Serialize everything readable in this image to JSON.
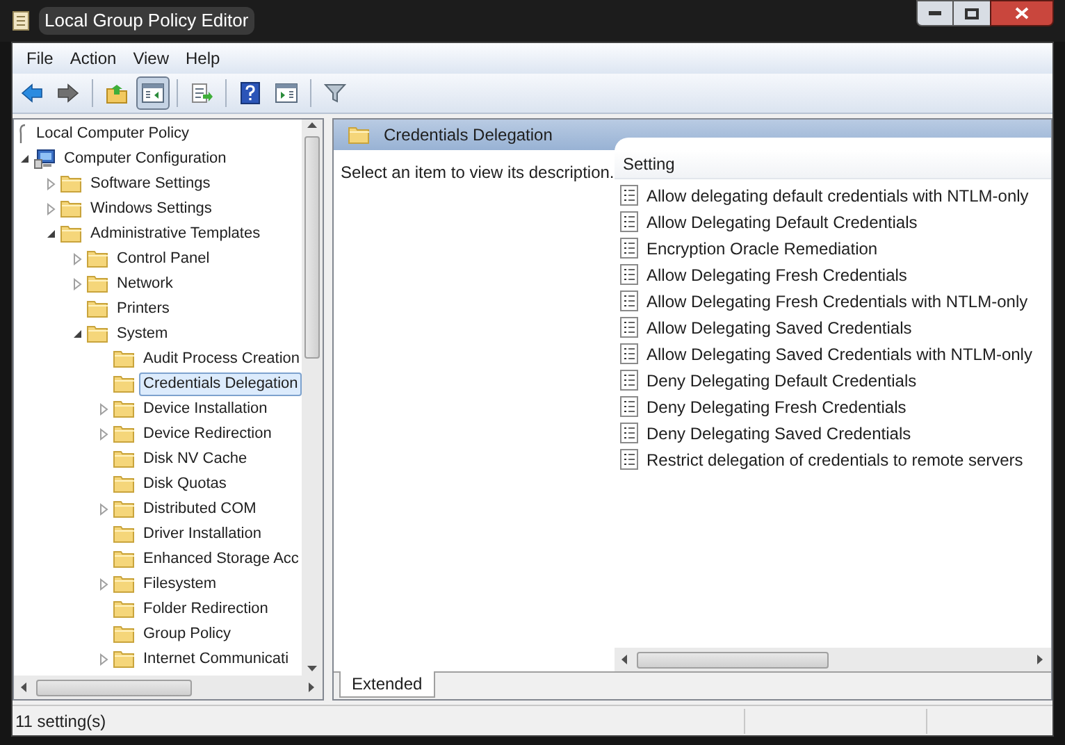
{
  "window": {
    "title": "Local Group Policy Editor"
  },
  "menu": [
    "File",
    "Action",
    "View",
    "Help"
  ],
  "toolbar": [
    [
      {
        "kind": "back",
        "pressed": false,
        "disabled": false
      },
      {
        "kind": "forward",
        "pressed": false,
        "disabled": true
      }
    ],
    [
      {
        "kind": "up",
        "pressed": false,
        "disabled": false
      },
      {
        "kind": "tree",
        "pressed": true,
        "disabled": false
      }
    ],
    [
      {
        "kind": "export",
        "pressed": false,
        "disabled": false
      }
    ],
    [
      {
        "kind": "help",
        "pressed": false,
        "disabled": false
      },
      {
        "kind": "pane",
        "pressed": false,
        "disabled": false
      }
    ],
    [
      {
        "kind": "filter",
        "pressed": false,
        "disabled": false
      }
    ]
  ],
  "tree": [
    {
      "label": "Local Computer Policy",
      "kind": "policy",
      "selected": false,
      "children": [
        {
          "label": "Computer Configuration",
          "kind": "computer",
          "expanded": true,
          "selected": false,
          "children": [
            {
              "label": "Software Settings",
              "kind": "folder",
              "expanded": false,
              "selected": false
            },
            {
              "label": "Windows Settings",
              "kind": "folder",
              "expanded": false,
              "selected": false
            },
            {
              "label": "Administrative Templates",
              "kind": "folder",
              "expanded": true,
              "selected": false,
              "children": [
                {
                  "label": "Control Panel",
                  "kind": "folder",
                  "expanded": false,
                  "selected": false
                },
                {
                  "label": "Network",
                  "kind": "folder",
                  "expanded": false,
                  "selected": false
                },
                {
                  "label": "Printers",
                  "kind": "folder",
                  "selected": false
                },
                {
                  "label": "System",
                  "kind": "folder",
                  "expanded": true,
                  "selected": false,
                  "children": [
                    {
                      "label": "Audit Process Creation",
                      "kind": "folder",
                      "selected": false
                    },
                    {
                      "label": "Credentials Delegation",
                      "kind": "folder",
                      "selected": true
                    },
                    {
                      "label": "Device Installation",
                      "kind": "folder",
                      "expanded": false,
                      "selected": false
                    },
                    {
                      "label": "Device Redirection",
                      "kind": "folder",
                      "expanded": false,
                      "selected": false
                    },
                    {
                      "label": "Disk NV Cache",
                      "kind": "folder",
                      "selected": false
                    },
                    {
                      "label": "Disk Quotas",
                      "kind": "folder",
                      "selected": false
                    },
                    {
                      "label": "Distributed COM",
                      "kind": "folder",
                      "expanded": false,
                      "selected": false
                    },
                    {
                      "label": "Driver Installation",
                      "kind": "folder",
                      "selected": false
                    },
                    {
                      "label": "Enhanced Storage Acc",
                      "kind": "folder",
                      "selected": false
                    },
                    {
                      "label": "Filesystem",
                      "kind": "folder",
                      "expanded": false,
                      "selected": false
                    },
                    {
                      "label": "Folder Redirection",
                      "kind": "folder",
                      "selected": false
                    },
                    {
                      "label": "Group Policy",
                      "kind": "folder",
                      "selected": false
                    },
                    {
                      "label": "Internet Communicati",
                      "kind": "folder",
                      "expanded": false,
                      "selected": false
                    }
                  ]
                }
              ]
            }
          ]
        }
      ]
    }
  ],
  "details": {
    "title": "Credentials Delegation",
    "description": "Select an item to view its description.",
    "column_header": "Setting",
    "rows": [
      {
        "label": "Allow delegating default credentials with NTLM-only",
        "selected": false
      },
      {
        "label": "Allow Delegating Default Credentials",
        "selected": false
      },
      {
        "label": "Encryption Oracle Remediation",
        "selected": false
      },
      {
        "label": "Allow Delegating Fresh Credentials",
        "selected": false
      },
      {
        "label": "Allow Delegating Fresh Credentials with NTLM-only",
        "selected": false
      },
      {
        "label": "Allow Delegating Saved Credentials",
        "selected": false
      },
      {
        "label": "Allow Delegating Saved Credentials with NTLM-only",
        "selected": false
      },
      {
        "label": "Deny Delegating Default Credentials",
        "selected": false
      },
      {
        "label": "Deny Delegating Fresh Credentials",
        "selected": false
      },
      {
        "label": "Deny Delegating Saved Credentials",
        "selected": false
      },
      {
        "label": "Restrict delegation of credentials to remote servers",
        "selected": false
      }
    ]
  },
  "view_tabs": [
    {
      "label": "Extended",
      "selected": true
    }
  ],
  "status_bar": "11 setting(s)"
}
